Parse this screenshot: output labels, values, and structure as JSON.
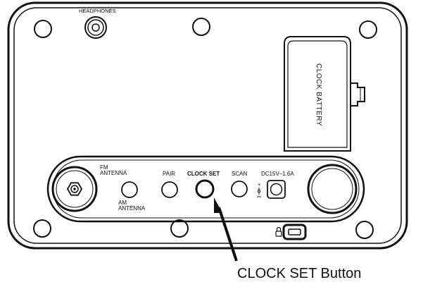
{
  "labels": {
    "headphones": "HEADPHONES",
    "clock_battery": "CLOCK  BATTERY",
    "fm_antenna_line1": "FM",
    "fm_antenna_line2": "ANTENNA",
    "am_antenna_line1": "AM",
    "am_antenna_line2": "ANTENNA",
    "pair": "PAIR",
    "clock_set": "CLOCK SET",
    "scan": "SCAN",
    "dc_input": "DC15V–1.6A",
    "callout": "CLOCK SET Button"
  },
  "icons": {
    "lock": "lock-icon",
    "power_polarity": "dc-polarity-icon"
  },
  "colors": {
    "line": "#111111",
    "background": "#ffffff"
  }
}
